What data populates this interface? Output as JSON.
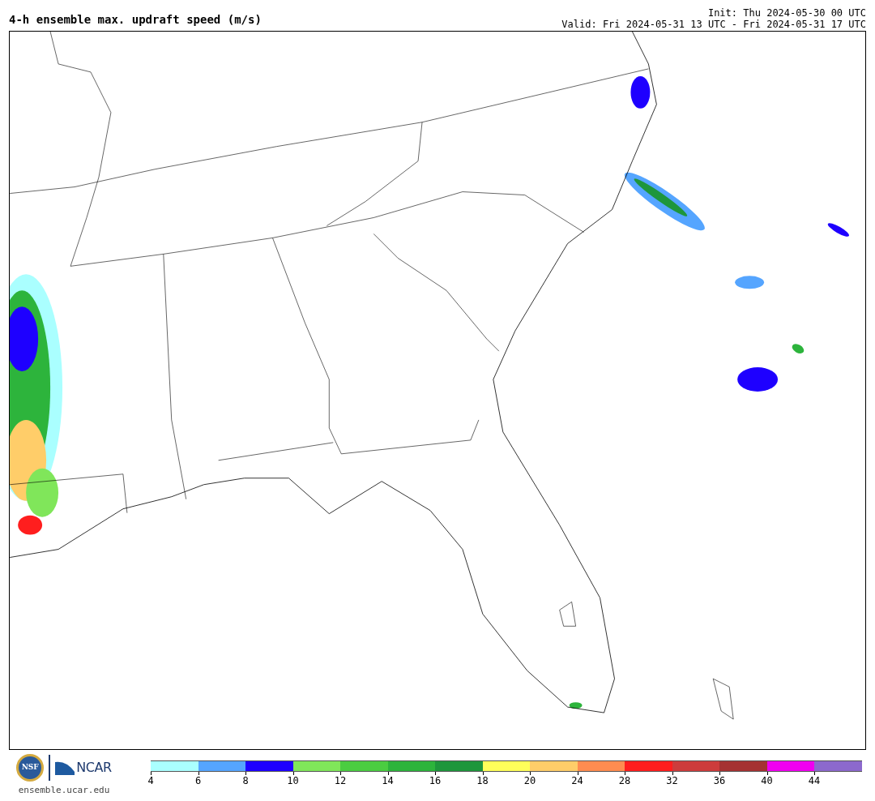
{
  "title": "4-h ensemble max. updraft speed (m/s)",
  "init": "Init: Thu 2024-05-30 00 UTC",
  "valid": "Valid: Fri 2024-05-31 13 UTC - Fri 2024-05-31 17 UTC",
  "logos": {
    "nsf": "NSF",
    "ncar": "NCAR",
    "url": "ensemble.ucar.edu"
  },
  "colorbar": [
    {
      "label": "4",
      "color": "#aaffff"
    },
    {
      "label": "6",
      "color": "#55a5ff"
    },
    {
      "label": "8",
      "color": "#1e00ff"
    },
    {
      "label": "10",
      "color": "#80e65a"
    },
    {
      "label": "12",
      "color": "#4bcd41"
    },
    {
      "label": "14",
      "color": "#2db43c"
    },
    {
      "label": "16",
      "color": "#1e963c"
    },
    {
      "label": "18",
      "color": "#ffff5a"
    },
    {
      "label": "20",
      "color": "#ffcd69"
    },
    {
      "label": "24",
      "color": "#ff8c50"
    },
    {
      "label": "28",
      "color": "#ff1e1e"
    },
    {
      "label": "32",
      "color": "#cd3c3c"
    },
    {
      "label": "36",
      "color": "#a53232"
    },
    {
      "label": "40",
      "color": "#f000f0"
    },
    {
      "label": "44",
      "color": "#8c69cd"
    }
  ]
}
